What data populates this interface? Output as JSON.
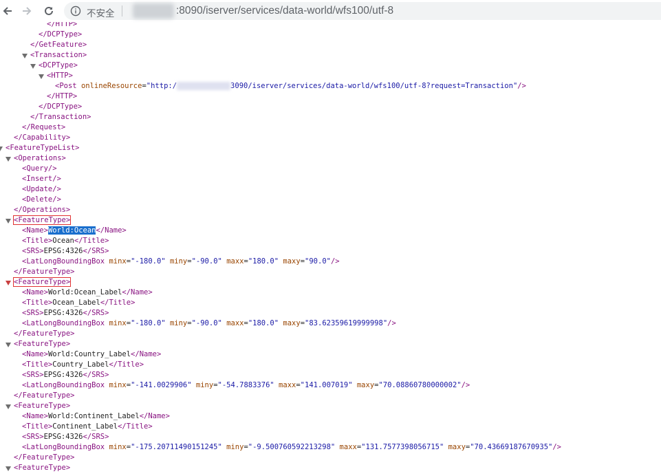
{
  "toolbar": {
    "insecure_label": "不安全",
    "url_visible": ":8090/iserver/services/data-world/wfs100/utf-8"
  },
  "xml": {
    "http_close": "</HTTP>",
    "dcptype_close": "</DCPType>",
    "getfeature_close": "</GetFeature>",
    "transaction_open": "<Transaction>",
    "dcptype_open": "<DCPType>",
    "http_open": "<HTTP>",
    "post_open": "<Post ",
    "post_attr": "onlineResource",
    "post_value_prefix": "\"http:/",
    "post_value_suffix": "3090/iserver/services/data-world/wfs100/utf-8?request=Transaction\"",
    "post_end": "/>",
    "transaction_close": "</Transaction>",
    "request_close": "</Request>",
    "capability_close": "</Capability>",
    "featuretypelist_open": "<FeatureTypeList>",
    "operations_open": "<Operations>",
    "ops": [
      "<Query/>",
      "<Insert/>",
      "<Update/>",
      "<Delete/>"
    ],
    "operations_close": "</Operations>",
    "featuretype_open": "<FeatureType>",
    "featuretype_close": "</FeatureType>",
    "name_open": "<Name>",
    "name_close": "</Name>",
    "title_open": "<Title>",
    "title_close": "</Title>",
    "srs_open": "<SRS>",
    "srs_close": "</SRS>",
    "bbox_open": "<LatLongBoundingBox ",
    "bbox_end": "/>",
    "attr_minx": "minx",
    "attr_miny": "miny",
    "attr_maxx": "maxx",
    "attr_maxy": "maxy",
    "features": [
      {
        "name": "World:Ocean",
        "title": "Ocean",
        "srs": "EPSG:4326",
        "minx": "\"-180.0\"",
        "miny": "\"-90.0\"",
        "maxx": "\"180.0\"",
        "maxy": "\"90.0\""
      },
      {
        "name": "World:Ocean_Label",
        "title": "Ocean_Label",
        "srs": "EPSG:4326",
        "minx": "\"-180.0\"",
        "miny": "\"-90.0\"",
        "maxx": "\"180.0\"",
        "maxy": "\"83.62359619999998\""
      },
      {
        "name": "World:Country_Label",
        "title": "Country_Label",
        "srs": "EPSG:4326",
        "minx": "\"-141.0029906\"",
        "miny": "\"-54.7883376\"",
        "maxx": "\"141.007019\"",
        "maxy": "\"70.08860780000002\""
      },
      {
        "name": "World:Continent_Label",
        "title": "Continent_Label",
        "srs": "EPSG:4326",
        "minx": "\"-175.20711490151245\"",
        "miny": "\"-9.500760592213298\"",
        "maxx": "\"131.7577398056715\"",
        "maxy": "\"70.43669187670935\""
      }
    ]
  }
}
